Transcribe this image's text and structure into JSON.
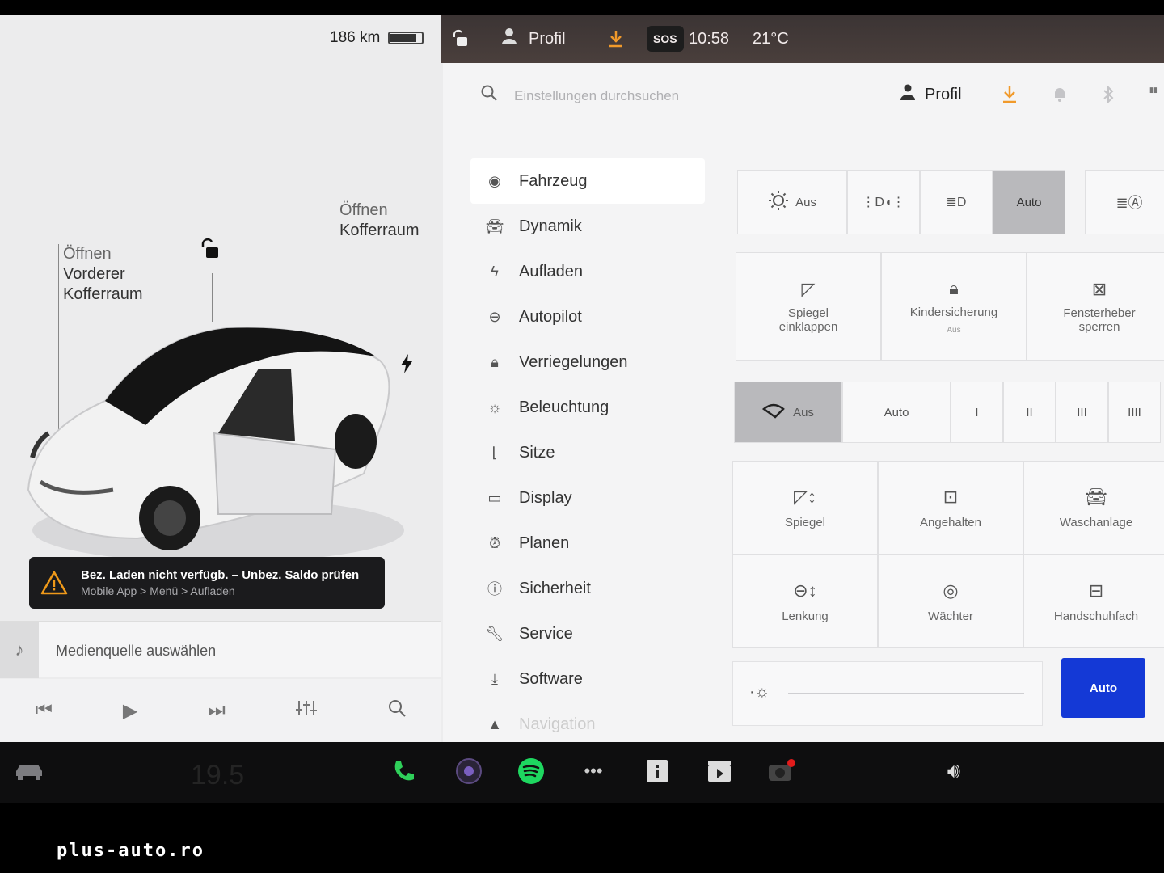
{
  "status": {
    "range": "186 km",
    "battery_level": 0.85,
    "profile": "Profil",
    "sos": "SOS",
    "time": "10:58",
    "temperature": "21°C"
  },
  "left": {
    "front_trunk": {
      "l1": "Öffnen",
      "l2": "Vorderer",
      "l3": "Kofferraum"
    },
    "rear_trunk": {
      "l1": "Öffnen",
      "l2": "Kofferraum"
    },
    "alert": {
      "line1": "Bez. Laden nicht verfügb. – Unbez. Saldo prüfen",
      "line2": "Mobile App > Menü > Aufladen"
    },
    "media_label": "Medienquelle auswählen"
  },
  "search": {
    "placeholder": "Einstellungen durchsuchen"
  },
  "settings_profile": "Profil",
  "nav": [
    {
      "label": "Fahrzeug",
      "icon": "toggle-icon"
    },
    {
      "label": "Dynamik",
      "icon": "car-icon"
    },
    {
      "label": "Aufladen",
      "icon": "bolt-icon"
    },
    {
      "label": "Autopilot",
      "icon": "steering-wheel-icon"
    },
    {
      "label": "Verriegelungen",
      "icon": "lock-icon"
    },
    {
      "label": "Beleuchtung",
      "icon": "sun-icon"
    },
    {
      "label": "Sitze",
      "icon": "seat-icon"
    },
    {
      "label": "Display",
      "icon": "display-icon"
    },
    {
      "label": "Planen",
      "icon": "alarm-clock-icon"
    },
    {
      "label": "Sicherheit",
      "icon": "info-circle-icon"
    },
    {
      "label": "Service",
      "icon": "wrench-icon"
    },
    {
      "label": "Software",
      "icon": "download-icon"
    },
    {
      "label": "Navigation",
      "icon": "navigation-icon"
    }
  ],
  "lights": {
    "off": "Aus",
    "auto": "Auto"
  },
  "cards": {
    "mirror_fold": {
      "l1": "Spiegel",
      "l2": "einklappen"
    },
    "child_lock": {
      "label": "Kindersicherung",
      "sub": "Aus"
    },
    "window_lock": {
      "l1": "Fensterheber",
      "l2": "sperren"
    }
  },
  "wipers": {
    "off": "Aus",
    "auto": "Auto",
    "s1": "I",
    "s2": "II",
    "s3": "III",
    "s4": "IIII"
  },
  "grid": {
    "mirror": "Spiegel",
    "hold": "Angehalten",
    "wash": "Waschanlage",
    "steering": "Lenkung",
    "sentry": "Wächter",
    "glovebox": "Handschuhfach"
  },
  "brightness": {
    "level": 0.0,
    "auto": "Auto"
  },
  "dock": {
    "temperature": "19.5"
  },
  "watermark": "plus-auto.ro"
}
